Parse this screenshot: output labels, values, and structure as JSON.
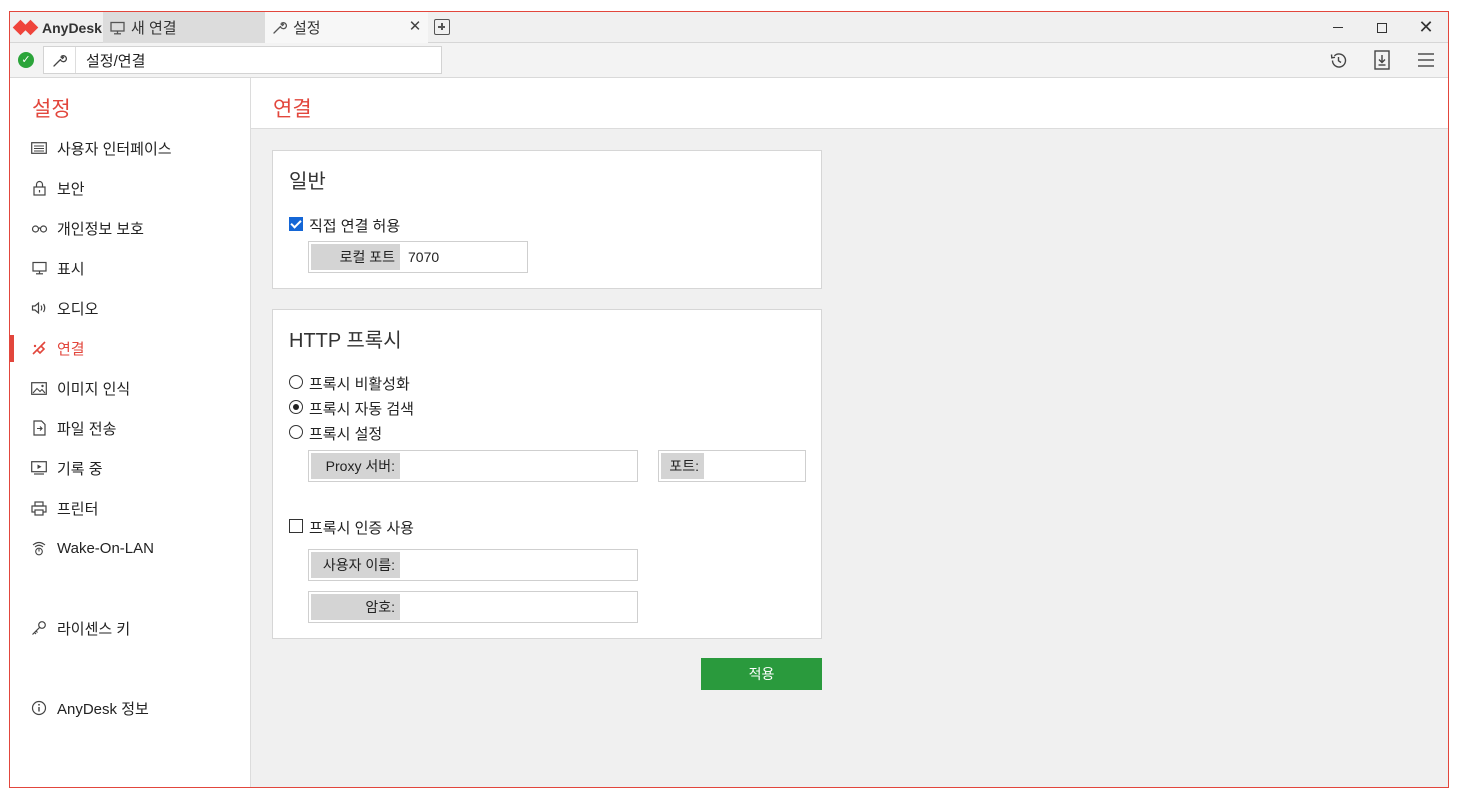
{
  "app": {
    "name": "AnyDesk"
  },
  "tabs": [
    {
      "label": "새 연결",
      "icon": "monitor-icon"
    },
    {
      "label": "설정",
      "icon": "wrench-icon"
    }
  ],
  "address": {
    "path": "설정/연결",
    "status": "connected"
  },
  "toolbar": {
    "icons": [
      "history-icon",
      "download-icon",
      "menu-icon"
    ]
  },
  "sidebar": {
    "title": "설정",
    "items": [
      {
        "label": "사용자 인터페이스",
        "icon": "keyboard-icon"
      },
      {
        "label": "보안",
        "icon": "lock-icon"
      },
      {
        "label": "개인정보 보호",
        "icon": "glasses-icon"
      },
      {
        "label": "표시",
        "icon": "monitor-icon"
      },
      {
        "label": "오디오",
        "icon": "speaker-icon"
      },
      {
        "label": "연결",
        "icon": "connection-icon",
        "active": true
      },
      {
        "label": "이미지 인식",
        "icon": "image-icon"
      },
      {
        "label": "파일 전송",
        "icon": "file-transfer-icon"
      },
      {
        "label": "기록 중",
        "icon": "recording-icon"
      },
      {
        "label": "프린터",
        "icon": "printer-icon"
      },
      {
        "label": "Wake-On-LAN",
        "icon": "wake-on-lan-icon"
      },
      {
        "label": "라이센스 키",
        "icon": "key-icon"
      },
      {
        "label": "AnyDesk 정보",
        "icon": "info-icon"
      }
    ]
  },
  "main": {
    "title": "연결",
    "general": {
      "title": "일반",
      "direct_connection_label": "직접 연결 허용",
      "direct_connection_checked": true,
      "local_port_label": "로컬 포트",
      "local_port_value": "7070"
    },
    "proxy": {
      "title": "HTTP 프록시",
      "options": [
        {
          "label": "프록시 비활성화",
          "selected": false
        },
        {
          "label": "프록시 자동 검색",
          "selected": true
        },
        {
          "label": "프록시 설정",
          "selected": false
        }
      ],
      "server_label": "Proxy 서버:",
      "server_value": "",
      "port_label": "포트:",
      "port_value": "",
      "auth_label": "프록시 인증 사용",
      "auth_checked": false,
      "username_label": "사용자 이름:",
      "username_value": "",
      "password_label": "암호:",
      "password_value": ""
    },
    "apply_label": "적용"
  },
  "colors": {
    "accent": "#e2463c",
    "apply": "#2a9a3d",
    "checkbox": "#1466d6"
  }
}
